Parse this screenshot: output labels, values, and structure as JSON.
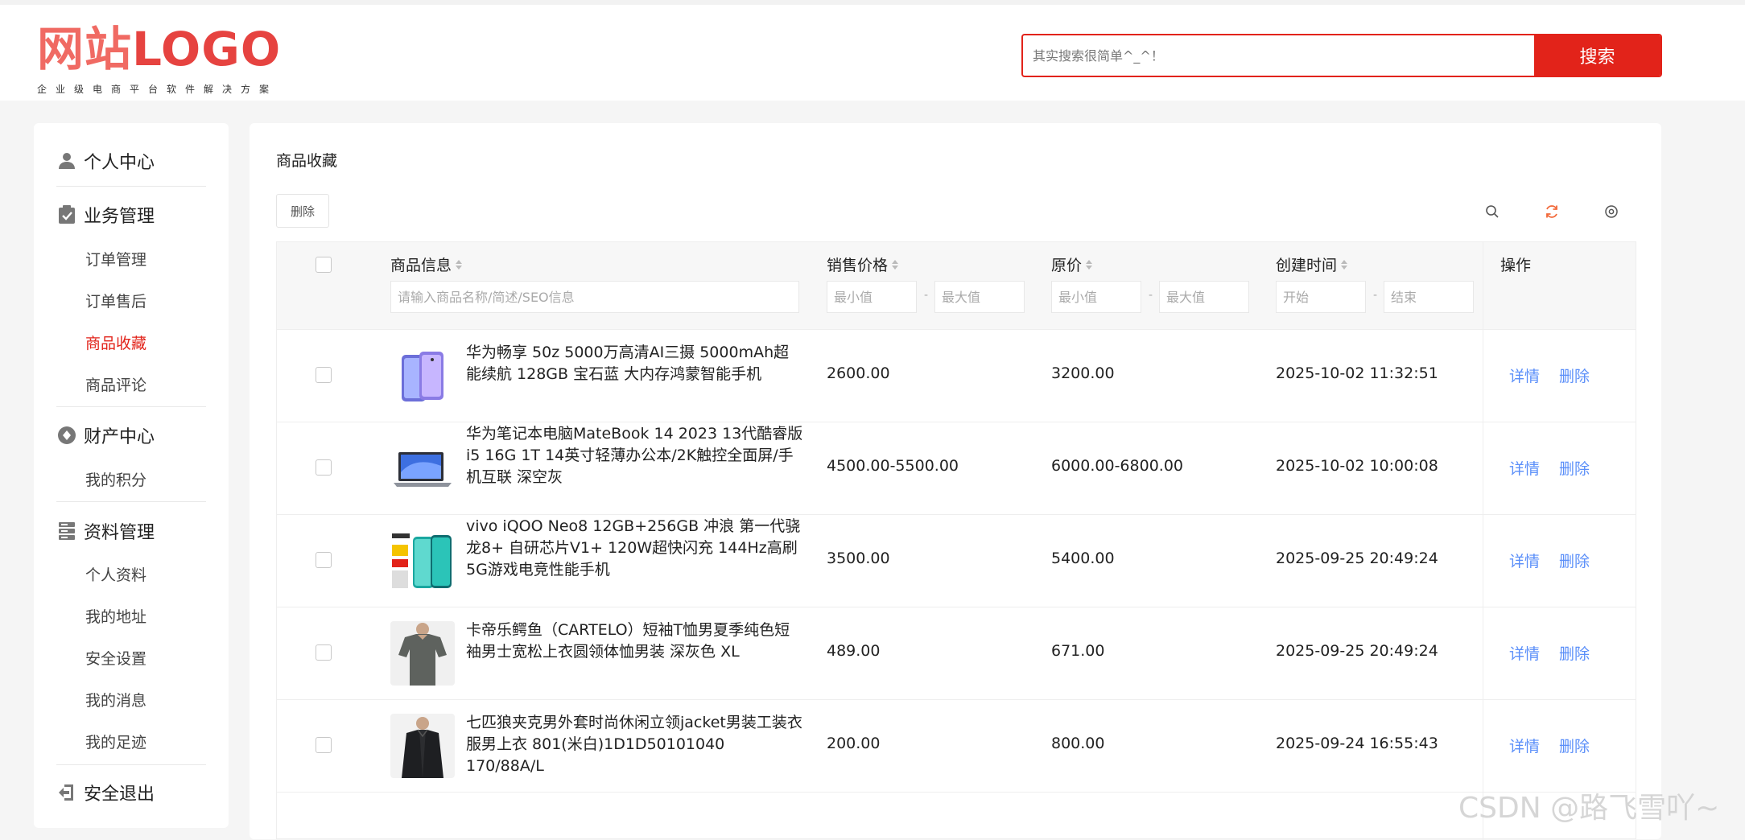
{
  "header": {
    "logo_cn": "网站",
    "logo_en": "LOGO",
    "logo_tagline": "企业级电商平台软件解决方案",
    "search_placeholder": "其实搜索很简单^_^！",
    "search_button": "搜索"
  },
  "sidebar": {
    "groups": [
      {
        "icon": "user-icon",
        "label": "个人中心",
        "items": []
      },
      {
        "icon": "clipboard-icon",
        "label": "业务管理",
        "items": [
          "订单管理",
          "订单售后",
          "商品收藏",
          "商品评论"
        ]
      },
      {
        "icon": "wallet-icon",
        "label": "财产中心",
        "items": [
          "我的积分"
        ]
      },
      {
        "icon": "database-icon",
        "label": "资料管理",
        "items": [
          "个人资料",
          "我的地址",
          "安全设置",
          "我的消息",
          "我的足迹"
        ]
      },
      {
        "icon": "logout-icon",
        "label": "安全退出",
        "items": []
      }
    ],
    "active_item": "商品收藏"
  },
  "main": {
    "title": "商品收藏",
    "delete_button": "删除",
    "toolbar_icons": [
      "search-icon",
      "refresh-icon",
      "settings-icon"
    ],
    "accent_color": "#e2231a",
    "link_color": "#5b8ff9",
    "columns": {
      "product": "商品信息",
      "price": "销售价格",
      "original": "原价",
      "created": "创建时间",
      "actions": "操作"
    },
    "filters": {
      "product_placeholder": "请输入商品名称/简述/SEO信息",
      "min": "最小值",
      "max": "最大值",
      "start": "开始",
      "end": "结束"
    },
    "rows": [
      {
        "name": "华为畅享 50z 5000万高清AI三摄 5000mAh超能续航 128GB 宝石蓝 大内存鸿蒙智能手机",
        "price": "2600.00",
        "original": "3200.00",
        "created": "2025-10-02 11:32:51",
        "detail": "详情",
        "delete": "删除",
        "thumb": "phone-image"
      },
      {
        "name": "华为笔记本电脑MateBook 14 2023 13代酷睿版 i5 16G 1T 14英寸轻薄办公本/2K触控全面屏/手机互联 深空灰",
        "price": "4500.00-5500.00",
        "original": "6000.00-6800.00",
        "created": "2025-10-02 10:00:08",
        "detail": "详情",
        "delete": "删除",
        "thumb": "laptop-image"
      },
      {
        "name": "vivo iQOO Neo8 12GB+256GB 冲浪 第一代骁龙8+ 自研芯片V1+ 120W超快闪充 144Hz高刷 5G游戏电竞性能手机",
        "price": "3500.00",
        "original": "5400.00",
        "created": "2025-09-25 20:49:24",
        "detail": "详情",
        "delete": "删除",
        "thumb": "vivo-phone-image"
      },
      {
        "name": "卡帝乐鳄鱼（CARTELO）短袖T恤男夏季纯色短袖男士宽松上衣圆领体恤男装 深灰色 XL",
        "price": "489.00",
        "original": "671.00",
        "created": "2025-09-25 20:49:24",
        "detail": "详情",
        "delete": "删除",
        "thumb": "tshirt-image"
      },
      {
        "name": "七匹狼夹克男外套时尚休闲立领jacket男装工装衣服男上衣 801(米白)1D1D50101040 170/88A/L",
        "price": "200.00",
        "original": "800.00",
        "created": "2025-09-24 16:55:43",
        "detail": "详情",
        "delete": "删除",
        "thumb": "jacket-image"
      }
    ]
  },
  "watermark": "CSDN @路飞雪吖~"
}
